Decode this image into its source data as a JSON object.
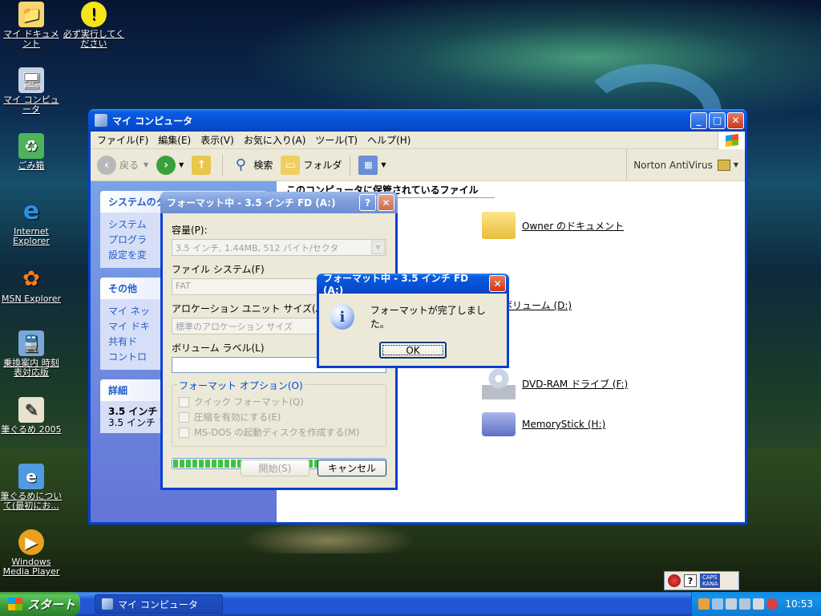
{
  "desktop": {
    "icons": [
      {
        "label": "マイ ドキュメント",
        "icon": "folder-docs-icon",
        "color": "#f5d76e"
      },
      {
        "label": "必ず実行してください",
        "icon": "warning-icon",
        "color": "#f6e51a"
      },
      {
        "label": "マイ コンピュータ",
        "icon": "computer-icon",
        "color": "#c7d3e6"
      },
      {
        "label": "ごみ箱",
        "icon": "recycle-bin-icon",
        "color": "#4fb35b"
      },
      {
        "label": "Internet Explorer",
        "icon": "ie-icon",
        "color": "#2f8de4"
      },
      {
        "label": "MSN Explorer",
        "icon": "msn-icon",
        "color": "#f37c21"
      },
      {
        "label": "乗換案内 時刻表対応版",
        "icon": "train-icon",
        "color": "#7ba6d8"
      },
      {
        "label": "筆ぐるめ 2005",
        "icon": "brush-icon",
        "color": "#e8e2cf"
      },
      {
        "label": "筆ぐるめについて(最初にお...",
        "icon": "ie-doc-icon",
        "color": "#4f9ae0"
      },
      {
        "label": "Windows Media Player",
        "icon": "media-player-icon",
        "color": "#e9a01d"
      }
    ]
  },
  "explorer": {
    "title": "マイ コンピュータ",
    "menu": [
      "ファイル(F)",
      "編集(E)",
      "表示(V)",
      "お気に入り(A)",
      "ツール(T)",
      "ヘルプ(H)"
    ],
    "toolbar": {
      "back": "戻る",
      "search": "検索",
      "folders": "フォルダ",
      "norton": "Norton AntiVirus"
    },
    "tasks_header": "システムのタ",
    "tasks": [
      "システム",
      "プログラ",
      "設定を変"
    ],
    "other_header": "その他",
    "other": [
      "マイ ネッ",
      "マイ ドキ",
      "共有ド",
      "コントロ"
    ],
    "details_header": "詳細",
    "details_title": "3.5 インチ",
    "details_sub": "3.5 インチ フ",
    "files_header": "このコンピュータに保管されているファイル",
    "items": [
      {
        "label": "Owner のドキュメント",
        "icon": "folder-icon"
      },
      {
        "label": "ボリューム (D:)",
        "icon": "drive-icon"
      },
      {
        "label": "DVD-RAM ドライブ (F:)",
        "icon": "dvd-drive-icon"
      },
      {
        "label": "MemoryStick (H:)",
        "icon": "memorystick-icon"
      }
    ]
  },
  "format_dialog": {
    "title": "フォーマット中 - 3.5 インチ FD (A:)",
    "capacity_label": "容量(P):",
    "capacity_value": "3.5 インチ, 1.44MB, 512 バイト/セクタ",
    "fs_label": "ファイル システム(F)",
    "fs_value": "FAT",
    "alloc_label": "アロケーション ユニット サイズ(A)",
    "alloc_value": "標準のアロケーション サイズ",
    "volume_label": "ボリューム ラベル(L)",
    "options_label": "フォーマット オプション(O)",
    "options": [
      "クイック フォーマット(Q)",
      "圧縮を有効にする(E)",
      "MS-DOS の起動ディスクを作成する(M)"
    ],
    "progress": 1.0,
    "start_button": "開始(S)",
    "cancel_button": "キャンセル"
  },
  "message_box": {
    "title": "フォーマット中 - 3.5 インチ FD (A:)",
    "text": "フォーマットが完了しました。",
    "ok": "OK"
  },
  "taskbar": {
    "start": "スタート",
    "task": "マイ コンピュータ",
    "clock": "10:53",
    "caps": "CAPS",
    "kana": "KANA"
  }
}
